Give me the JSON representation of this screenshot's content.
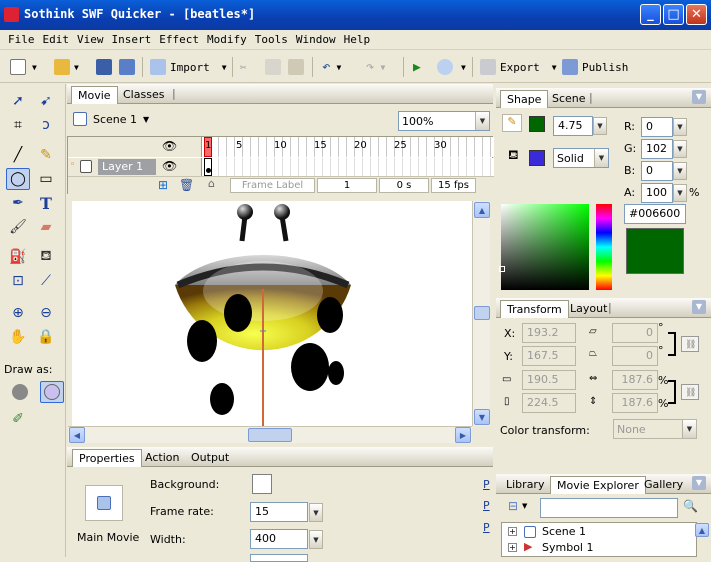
{
  "window": {
    "title": "Sothink SWF Quicker - [beatles*]",
    "minimize": "_",
    "maximize": "□",
    "close": "✕"
  },
  "menu": [
    "File",
    "Edit",
    "View",
    "Insert",
    "Effect",
    "Modify",
    "Tools",
    "Window",
    "Help"
  ],
  "toolbar": {
    "import_label": "Import",
    "export_label": "Export",
    "publish_label": "Publish"
  },
  "toolbox": {
    "draw_as_label": "Draw as:"
  },
  "document": {
    "tabs": [
      "Movie",
      "Classes"
    ],
    "scene": "Scene 1",
    "zoom": "100%",
    "layer_name": "Layer 1",
    "frame_numbers": [
      "1",
      "5",
      "10",
      "15",
      "20",
      "25",
      "30"
    ],
    "frame_label_placeholder": "Frame Label",
    "current_frame": "1",
    "time": "0 s",
    "fps": "15 fps"
  },
  "shape_panel": {
    "tabs": [
      "Shape",
      "Scene"
    ],
    "stroke_width": "4.75",
    "fill_style": "Solid",
    "rgb": {
      "r_label": "R:",
      "r": "0",
      "g_label": "G:",
      "g": "102",
      "b_label": "B:",
      "b": "0",
      "a_label": "A:",
      "a": "100",
      "percent": "%"
    },
    "hex": "#006600",
    "color": "#006600"
  },
  "transform_panel": {
    "tabs": [
      "Transform",
      "Layout"
    ],
    "x_label": "X:",
    "x": "193.2",
    "y_label": "Y:",
    "y": "167.5",
    "w": "190.5",
    "h": "224.5",
    "skew_x": "0",
    "skew_y": "0",
    "scale_w": "187.6",
    "scale_h": "187.6",
    "degree": "°",
    "percent": "%",
    "color_transform_label": "Color transform:",
    "color_transform_value": "None"
  },
  "library_panel": {
    "tabs": [
      "Library",
      "Movie Explorer",
      "Gallery"
    ],
    "items": [
      "Scene 1",
      "Symbol 1"
    ]
  },
  "properties_panel": {
    "tabs": [
      "Properties",
      "Action",
      "Output"
    ],
    "main_label": "Main Movie",
    "background_label": "Background:",
    "frame_rate_label": "Frame rate:",
    "frame_rate": "15",
    "width_label": "Width:",
    "width": "400",
    "side_letters": [
      "P",
      "P",
      "P"
    ]
  }
}
